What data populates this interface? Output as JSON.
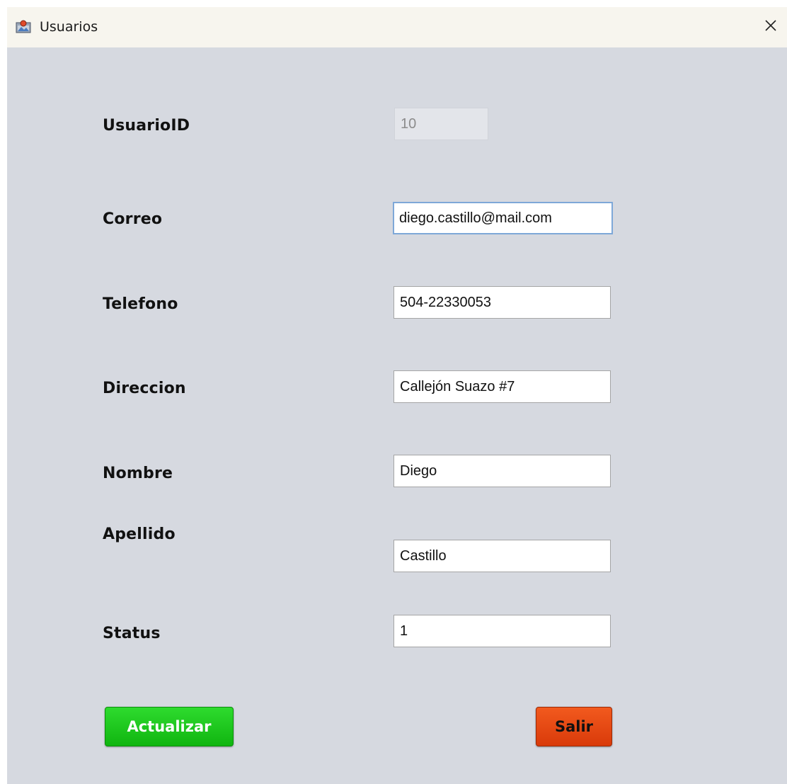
{
  "window": {
    "title": "Usuarios"
  },
  "form": {
    "usuario_id": {
      "label": "UsuarioID",
      "value": "10"
    },
    "correo": {
      "label": "Correo",
      "value": "diego.castillo@mail.com"
    },
    "telefono": {
      "label": "Telefono",
      "value": "504-22330053"
    },
    "direccion": {
      "label": "Direccion",
      "value": "Callejón Suazo #7"
    },
    "nombre": {
      "label": "Nombre",
      "value": "Diego"
    },
    "apellido": {
      "label": "Apellido",
      "value": "Castillo"
    },
    "status": {
      "label": "Status",
      "value": "1"
    }
  },
  "buttons": {
    "update_label": "Actualizar",
    "exit_label": "Salir"
  },
  "icons": {
    "app": "java-app-icon",
    "close": "close-icon"
  },
  "colors": {
    "background": "#d6d9e0",
    "titlebar": "#f7f5ee",
    "update_button": "#1fcc1f",
    "exit_button": "#e84a14"
  }
}
